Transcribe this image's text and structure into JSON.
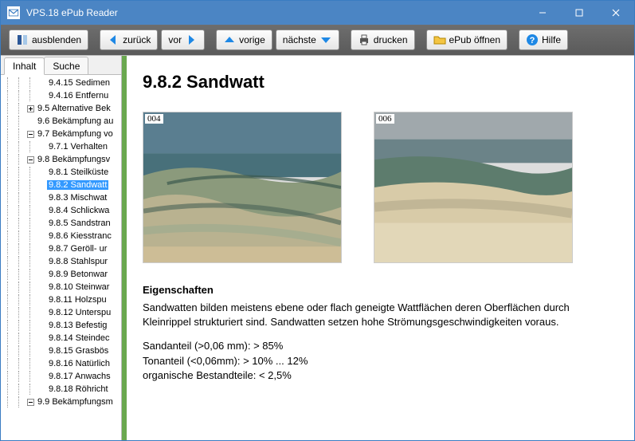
{
  "window": {
    "title": "VPS.18 ePub Reader"
  },
  "toolbar": {
    "hide": "ausblenden",
    "back": "zurück",
    "forward": "vor",
    "prev": "vorige",
    "next": "nächste",
    "print": "drucken",
    "open": "ePub öffnen",
    "help": "Hilfe"
  },
  "tabs": {
    "content": "Inhalt",
    "search": "Suche"
  },
  "tree": [
    {
      "ind": 3,
      "tw": "",
      "label": "9.4.15 Sedimen"
    },
    {
      "ind": 3,
      "tw": "",
      "label": "9.4.16 Entfernu"
    },
    {
      "ind": 2,
      "tw": "plus",
      "label": "9.5 Alternative Bek"
    },
    {
      "ind": 2,
      "tw": "",
      "label": "9.6 Bekämpfung au"
    },
    {
      "ind": 2,
      "tw": "minus",
      "label": "9.7 Bekämpfung vo"
    },
    {
      "ind": 3,
      "tw": "",
      "label": "9.7.1 Verhalten"
    },
    {
      "ind": 2,
      "tw": "minus",
      "label": "9.8 Bekämpfungsv"
    },
    {
      "ind": 3,
      "tw": "",
      "label": "9.8.1 Steilküste"
    },
    {
      "ind": 3,
      "tw": "",
      "label": "9.8.2 Sandwatt",
      "selected": true
    },
    {
      "ind": 3,
      "tw": "",
      "label": "9.8.3 Mischwat"
    },
    {
      "ind": 3,
      "tw": "",
      "label": "9.8.4 Schlickwa"
    },
    {
      "ind": 3,
      "tw": "",
      "label": "9.8.5 Sandstran"
    },
    {
      "ind": 3,
      "tw": "",
      "label": "9.8.6 Kiesstranc"
    },
    {
      "ind": 3,
      "tw": "",
      "label": "9.8.7 Geröll- ur"
    },
    {
      "ind": 3,
      "tw": "",
      "label": "9.8.8 Stahlspur"
    },
    {
      "ind": 3,
      "tw": "",
      "label": "9.8.9 Betonwar"
    },
    {
      "ind": 3,
      "tw": "",
      "label": "9.8.10 Steinwar"
    },
    {
      "ind": 3,
      "tw": "",
      "label": "9.8.11 Holzspu"
    },
    {
      "ind": 3,
      "tw": "",
      "label": "9.8.12 Unterspu"
    },
    {
      "ind": 3,
      "tw": "",
      "label": "9.8.13 Befestig"
    },
    {
      "ind": 3,
      "tw": "",
      "label": "9.8.14 Steindec"
    },
    {
      "ind": 3,
      "tw": "",
      "label": "9.8.15 Grasbös"
    },
    {
      "ind": 3,
      "tw": "",
      "label": "9.8.16 Natürlich"
    },
    {
      "ind": 3,
      "tw": "",
      "label": "9.8.17 Anwachs"
    },
    {
      "ind": 3,
      "tw": "",
      "label": "9.8.18 Röhricht"
    },
    {
      "ind": 2,
      "tw": "minus",
      "label": "9.9 Bekämpfungsm"
    }
  ],
  "page": {
    "heading": "9.8.2  Sandwatt",
    "fig1_id": "004",
    "fig2_id": "006",
    "sub1": "Eigenschaften",
    "para1": "Sandwatten bilden meistens ebene oder flach geneigte Wattflächen deren Oberflächen durch Kleinrippel strukturiert sind. Sandwatten setzen hohe Strömungsgeschwindigkeiten voraus.",
    "line1": "Sandanteil (>0,06 mm): > 85%",
    "line2": "Tonanteil (<0,06mm): > 10%  ... 12%",
    "line3": "organische Bestandteile: < 2,5%"
  }
}
